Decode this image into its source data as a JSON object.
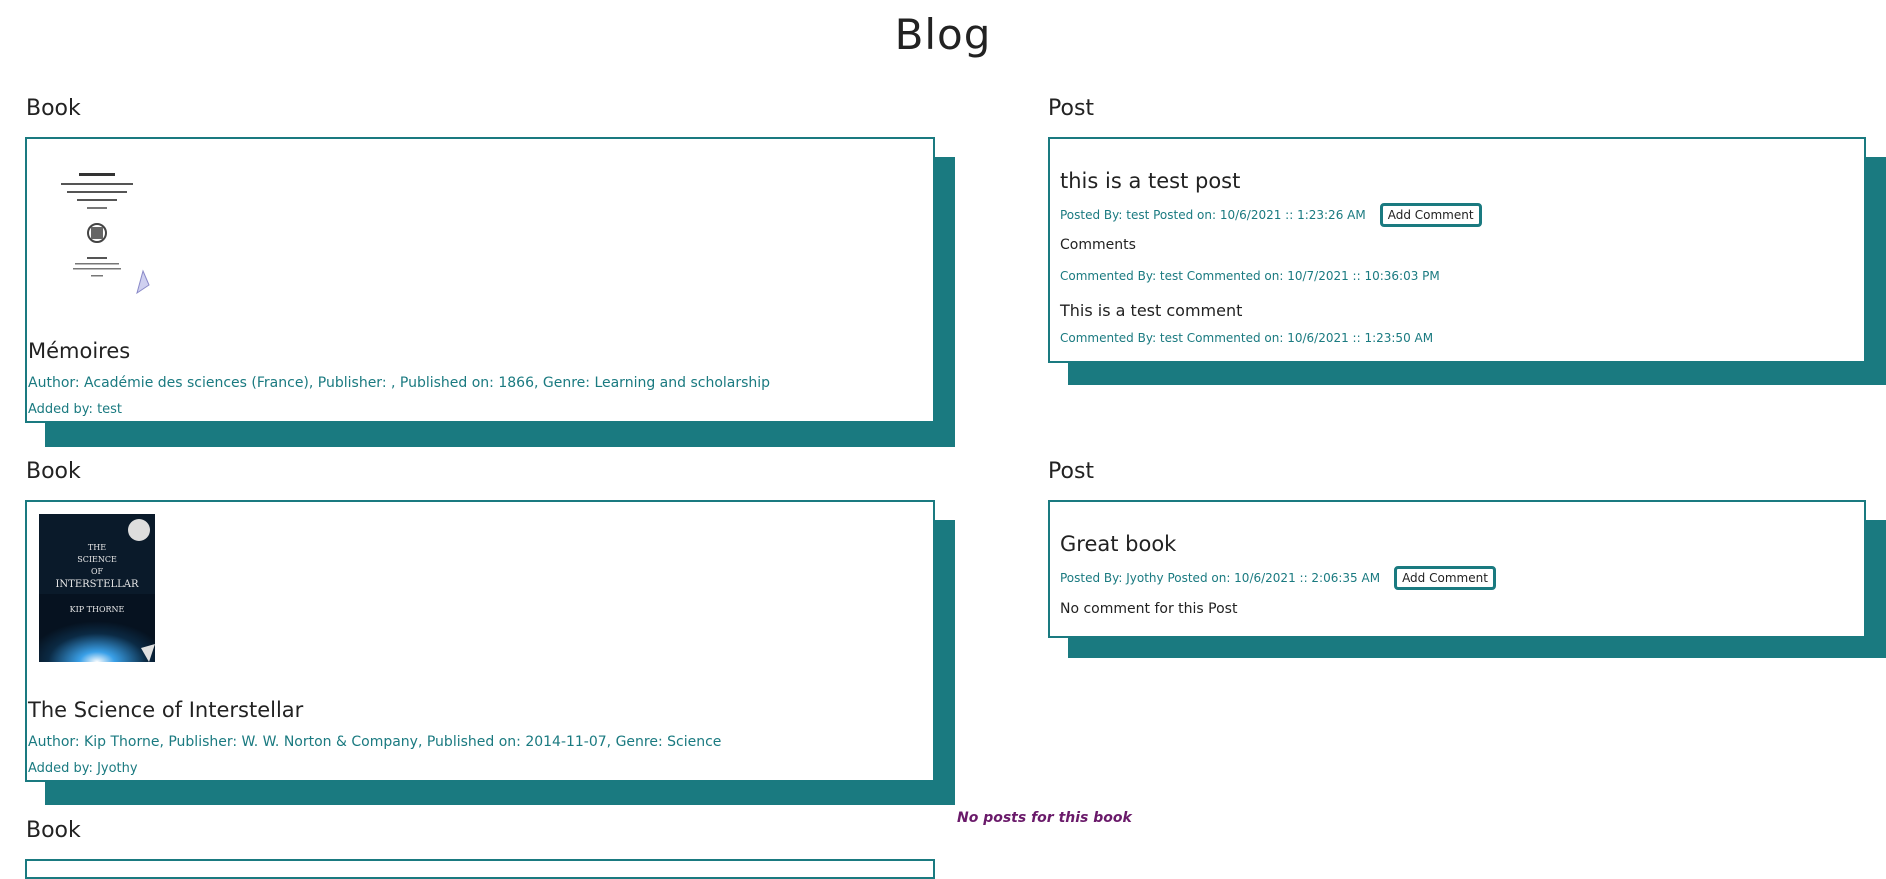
{
  "page": {
    "title": "Blog"
  },
  "rows": [
    {
      "book": {
        "section_label": "Book",
        "title": "Mémoires",
        "meta": "Author: Académie des sciences (France), Publisher: , Published on: 1866, Genre: Learning and scholarship",
        "added_by": "Added by: test",
        "cover": "memoires-cover"
      },
      "post": {
        "section_label": "Post",
        "title": "this is a test post",
        "meta": "Posted By: test Posted on: 10/6/2021 :: 1:23:26 AM",
        "add_comment_label": "Add Comment",
        "comments_heading": "Comments",
        "comments": [
          {
            "meta_before": "Commented By: test Commented on: 10/7/2021 :: 10:36:03 PM"
          },
          {
            "text": "This is a test comment",
            "meta": "Commented By: test Commented on: 10/6/2021 :: 1:23:50 AM"
          }
        ]
      }
    },
    {
      "book": {
        "section_label": "Book",
        "title": "The Science of Interstellar",
        "meta": "Author: Kip Thorne, Publisher: W. W. Norton & Company, Published on: 2014-11-07, Genre: Science",
        "added_by": "Added by: Jyothy",
        "cover": "interstellar-cover",
        "cover_text": [
          "THE",
          "SCIENCE",
          "OF",
          "INTERSTELLAR",
          "KIP THORNE"
        ]
      },
      "post": {
        "section_label": "Post",
        "title": "Great book",
        "meta": "Posted By: Jyothy Posted on: 10/6/2021 :: 2:06:35 AM",
        "add_comment_label": "Add Comment",
        "no_comment_text": "No comment for this Post"
      }
    },
    {
      "book": {
        "section_label": "Book"
      },
      "no_posts_text": "No posts for this book"
    }
  ],
  "colors": {
    "accent": "#1a7a80",
    "no_posts": "#6a1a6a"
  }
}
